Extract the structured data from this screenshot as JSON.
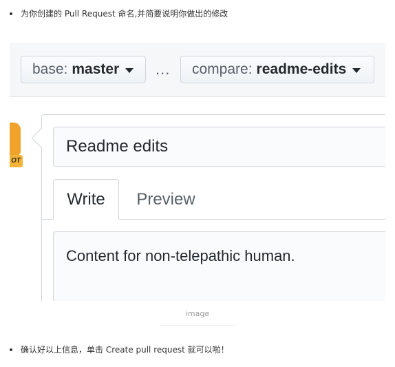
{
  "intro_bullet": "为你创建的 Pull Request 命名,并简要说明你做出的修改",
  "compare_bar": {
    "base_prefix": "base:",
    "base_branch": "master",
    "separator": "...",
    "compare_prefix": "compare:",
    "compare_branch": "readme-edits"
  },
  "avatar": {
    "tag_text": "OT"
  },
  "form": {
    "title_value": "Readme edits",
    "tabs": [
      {
        "label": "Write",
        "active": true
      },
      {
        "label": "Preview",
        "active": false
      }
    ],
    "body_value": "Content for non-telepathic human."
  },
  "caption": "image",
  "confirm_bullet": "确认好以上信息，单击 Create pull request 就可以啦！",
  "colors": {
    "accent": "#f0a32a",
    "border": "#d1d5da",
    "text": "#24292e",
    "muted": "#586069"
  }
}
